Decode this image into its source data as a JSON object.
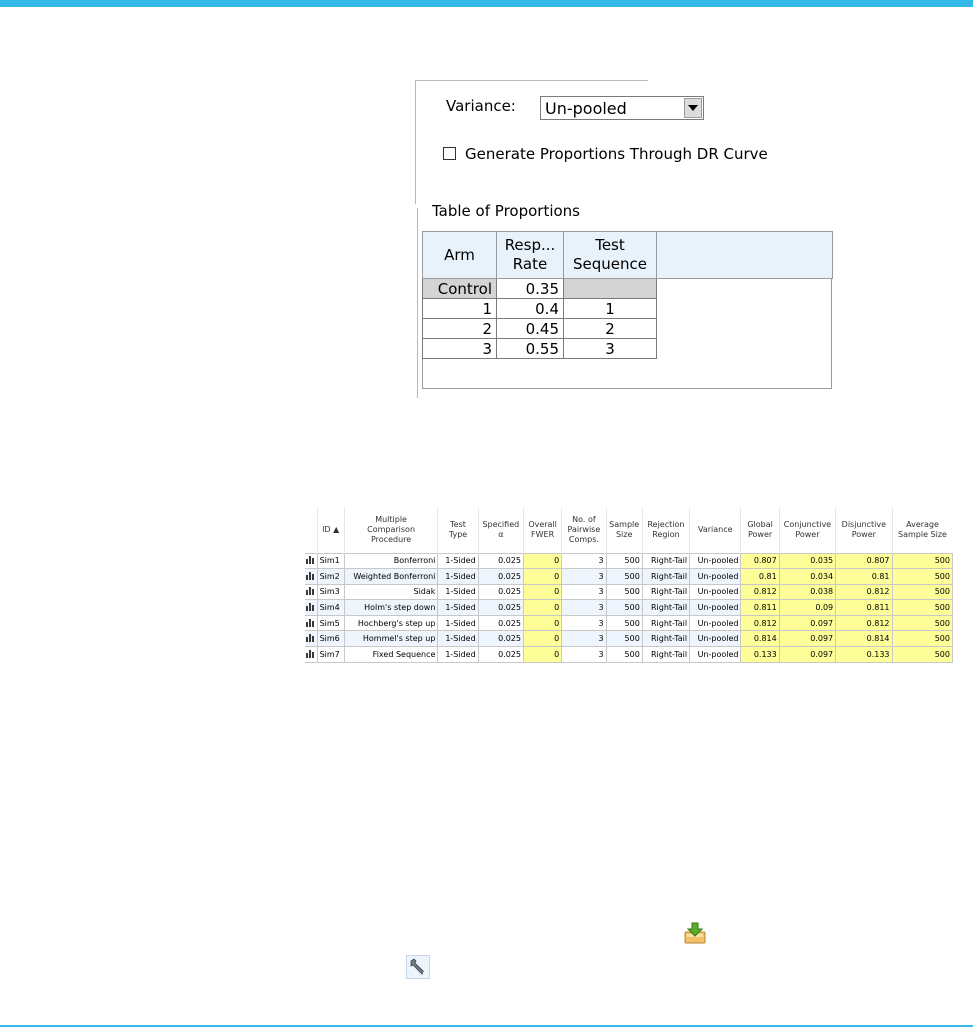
{
  "settings": {
    "variance_label": "Variance:",
    "variance_value": "Un-pooled",
    "generate_label": "Generate Proportions Through DR Curve",
    "generate_checked": false
  },
  "proportions": {
    "title": "Table of Proportions",
    "headers": {
      "arm": "Arm",
      "resp_1": "Resp...",
      "resp_2": "Rate",
      "seq_1": "Test",
      "seq_2": "Sequence"
    },
    "rows": [
      {
        "arm": "Control",
        "rate": "0.35",
        "seq": ""
      },
      {
        "arm": "1",
        "rate": "0.4",
        "seq": "1"
      },
      {
        "arm": "2",
        "rate": "0.45",
        "seq": "2"
      },
      {
        "arm": "3",
        "rate": "0.55",
        "seq": "3"
      }
    ]
  },
  "results": {
    "headers": {
      "id": "ID ▲",
      "mcp_1": "Multiple",
      "mcp_2": "Comparison",
      "mcp_3": "Procedure",
      "tt_1": "Test",
      "tt_2": "Type",
      "sa_1": "Specified",
      "sa_2": "α",
      "op_1": "Overall",
      "op_2": "FWER",
      "np_1": "No. of",
      "np_2": "Pairwise",
      "np_3": "Comps.",
      "ss_1": "Sample",
      "ss_2": "Size",
      "rr_1": "Rejection",
      "rr_2": "Region",
      "var": "Variance",
      "gp_1": "Global",
      "gp_2": "Power",
      "cp_1": "Conjunctive",
      "cp_2": "Power",
      "dp_1": "Disjunctive",
      "dp_2": "Power",
      "av_1": "Average",
      "av_2": "Sample Size"
    },
    "rows": [
      {
        "id": "Sim1",
        "mcp": "Bonferroni",
        "type": "1-Sided",
        "alpha": "0.025",
        "fwer": "0",
        "comps": "3",
        "size": "500",
        "region": "Right-Tail",
        "variance": "Un-pooled",
        "global": "0.807",
        "conj": "0.035",
        "disj": "0.807",
        "avg": "500"
      },
      {
        "id": "Sim2",
        "mcp": "Weighted Bonferroni",
        "type": "1-Sided",
        "alpha": "0.025",
        "fwer": "0",
        "comps": "3",
        "size": "500",
        "region": "Right-Tail",
        "variance": "Un-pooled",
        "global": "0.81",
        "conj": "0.034",
        "disj": "0.81",
        "avg": "500"
      },
      {
        "id": "Sim3",
        "mcp": "Sidak",
        "type": "1-Sided",
        "alpha": "0.025",
        "fwer": "0",
        "comps": "3",
        "size": "500",
        "region": "Right-Tail",
        "variance": "Un-pooled",
        "global": "0.812",
        "conj": "0.038",
        "disj": "0.812",
        "avg": "500"
      },
      {
        "id": "Sim4",
        "mcp": "Holm's step down",
        "type": "1-Sided",
        "alpha": "0.025",
        "fwer": "0",
        "comps": "3",
        "size": "500",
        "region": "Right-Tail",
        "variance": "Un-pooled",
        "global": "0.811",
        "conj": "0.09",
        "disj": "0.811",
        "avg": "500"
      },
      {
        "id": "Sim5",
        "mcp": "Hochberg's step up",
        "type": "1-Sided",
        "alpha": "0.025",
        "fwer": "0",
        "comps": "3",
        "size": "500",
        "region": "Right-Tail",
        "variance": "Un-pooled",
        "global": "0.812",
        "conj": "0.097",
        "disj": "0.812",
        "avg": "500"
      },
      {
        "id": "Sim6",
        "mcp": "Hommel's step up",
        "type": "1-Sided",
        "alpha": "0.025",
        "fwer": "0",
        "comps": "3",
        "size": "500",
        "region": "Right-Tail",
        "variance": "Un-pooled",
        "global": "0.814",
        "conj": "0.097",
        "disj": "0.814",
        "avg": "500"
      },
      {
        "id": "Sim7",
        "mcp": "Fixed Sequence",
        "type": "1-Sided",
        "alpha": "0.025",
        "fwer": "0",
        "comps": "3",
        "size": "500",
        "region": "Right-Tail",
        "variance": "Un-pooled",
        "global": "0.133",
        "conj": "0.097",
        "disj": "0.133",
        "avg": "500"
      }
    ]
  },
  "icons": {
    "save": "save-to-library-icon",
    "tools": "wrench-icon"
  },
  "colors": {
    "accent": "#33b8e8",
    "highlight": "#ffff99",
    "header_bg": "#e8f2fb"
  }
}
